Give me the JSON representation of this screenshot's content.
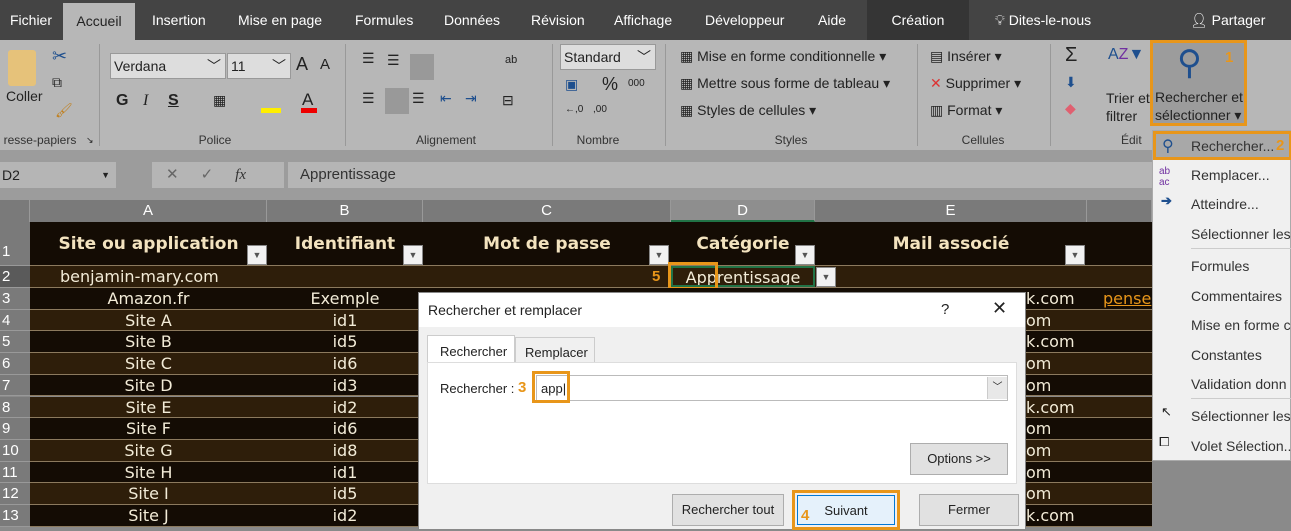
{
  "tabs": [
    "Fichier",
    "Accueil",
    "Insertion",
    "Mise en page",
    "Formules",
    "Données",
    "Révision",
    "Affichage",
    "Développeur",
    "Aide",
    "Création"
  ],
  "tell_me": "Dites-le-nous",
  "share": "Partager",
  "ribbon": {
    "clipboard": {
      "paste": "Coller",
      "group": "resse-papiers"
    },
    "font": {
      "name": "Verdana",
      "size": "11",
      "bold": "G",
      "italic": "I",
      "underline": "S",
      "group": "Police"
    },
    "alignment": {
      "group": "Alignement"
    },
    "number": {
      "format": "Standard",
      "group": "Nombre"
    },
    "styles": {
      "items": [
        "Mise en forme conditionnelle",
        "Mettre sous forme de tableau",
        "Styles de cellules"
      ],
      "group": "Styles"
    },
    "cells": {
      "items": [
        "Insérer",
        "Supprimer",
        "Format"
      ],
      "group": "Cellules"
    },
    "editing": {
      "sort": "Trier et",
      "sort2": "filtrer",
      "find": "Rechercher et",
      "find2": "sélectionner",
      "group": "Édit"
    }
  },
  "formula_bar": {
    "name_box": "D2",
    "fx": "fx",
    "value": "Apprentissage"
  },
  "columns": [
    "A",
    "B",
    "C",
    "D",
    "E"
  ],
  "headers": [
    "Site ou application",
    "Identifiant",
    "Mot de passe",
    "Catégorie",
    "Mail associé"
  ],
  "row2": {
    "a": "benjamin-mary.com",
    "d": "Apprentissage"
  },
  "rows": [
    {
      "n": "3",
      "a": "Amazon.fr",
      "b": "Exemple",
      "e": "k.com",
      "f": "pense"
    },
    {
      "n": "4",
      "a": "Site A",
      "b": "id1",
      "e": "om"
    },
    {
      "n": "5",
      "a": "Site B",
      "b": "id5",
      "e": "k.com"
    },
    {
      "n": "6",
      "a": "Site C",
      "b": "id6",
      "e": "om"
    },
    {
      "n": "7",
      "a": "Site D",
      "b": "id3",
      "e": "om"
    },
    {
      "n": "8",
      "a": "Site E",
      "b": "id2",
      "e": "k.com"
    },
    {
      "n": "9",
      "a": "Site F",
      "b": "id6",
      "e": "om"
    },
    {
      "n": "10",
      "a": "Site G",
      "b": "id8",
      "e": "om"
    },
    {
      "n": "11",
      "a": "Site H",
      "b": "id1",
      "e": "om"
    },
    {
      "n": "12",
      "a": "Site I",
      "b": "id5",
      "e": "om"
    },
    {
      "n": "13",
      "a": "Site J",
      "b": "id2",
      "e": "k.com"
    }
  ],
  "menu": [
    "Rechercher...",
    "Remplacer...",
    "Atteindre...",
    "Sélectionner les",
    "Formules",
    "Commentaires",
    "Mise en forme c",
    "Constantes",
    "Validation donn",
    "Sélectionner les",
    "Volet Sélection..."
  ],
  "dialog": {
    "title": "Rechercher et remplacer",
    "help": "?",
    "tabs": [
      "Rechercher",
      "Remplacer"
    ],
    "find_label": "Rechercher :",
    "find_value": "app",
    "options": "Options >>",
    "find_all": "Rechercher tout",
    "next": "Suivant",
    "close": "Fermer"
  },
  "steps": [
    "1",
    "2",
    "3",
    "4",
    "5"
  ],
  "colors": {
    "accent": "#e8961a",
    "row_dark": "#140c04",
    "row_brown": "#2e1e0a"
  }
}
